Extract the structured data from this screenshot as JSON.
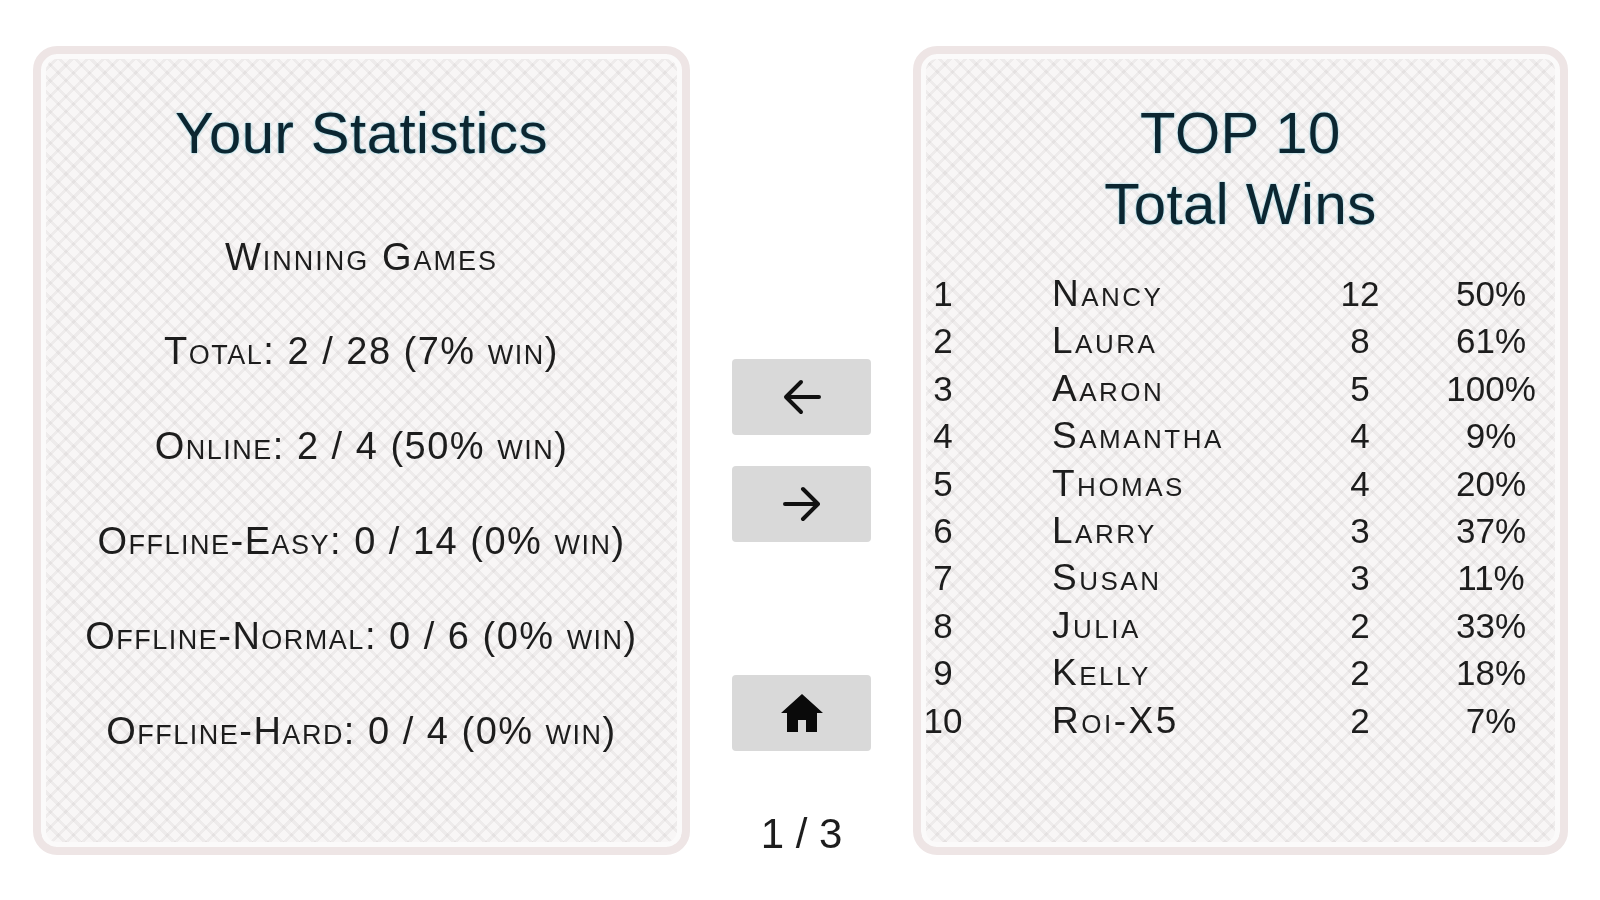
{
  "statistics_card": {
    "title": "Your Statistics",
    "heading": "Winning Games",
    "lines": [
      "Total: 2 / 28 (7% win)",
      "Online: 2 / 4 (50% win)",
      "Offline-Easy: 0 / 14 (0% win)",
      "Offline-Normal: 0 / 6 (0% win)",
      "Offline-Hard: 0 / 4 (0% win)"
    ]
  },
  "navigation": {
    "buttons": [
      {
        "kind": "previous"
      },
      {
        "kind": "next"
      },
      {
        "kind": "home"
      }
    ],
    "page_indicator": "1 / 3"
  },
  "leaderboard_card": {
    "title_lines": [
      "TOP 10",
      "Total Wins"
    ],
    "rows": [
      {
        "rank": "1",
        "name": "Nancy",
        "wins": "12",
        "win_rate": "50%"
      },
      {
        "rank": "2",
        "name": "Laura",
        "wins": "8",
        "win_rate": "61%"
      },
      {
        "rank": "3",
        "name": "Aaron",
        "wins": "5",
        "win_rate": "100%"
      },
      {
        "rank": "4",
        "name": "Samantha",
        "wins": "4",
        "win_rate": "9%"
      },
      {
        "rank": "5",
        "name": "Thomas",
        "wins": "4",
        "win_rate": "20%"
      },
      {
        "rank": "6",
        "name": "Larry",
        "wins": "3",
        "win_rate": "37%"
      },
      {
        "rank": "7",
        "name": "Susan",
        "wins": "3",
        "win_rate": "11%"
      },
      {
        "rank": "8",
        "name": "Julia",
        "wins": "2",
        "win_rate": "33%"
      },
      {
        "rank": "9",
        "name": "Kelly",
        "wins": "2",
        "win_rate": "18%"
      },
      {
        "rank": "10",
        "name": "Roi-X5",
        "wins": "2",
        "win_rate": "7%"
      }
    ]
  }
}
